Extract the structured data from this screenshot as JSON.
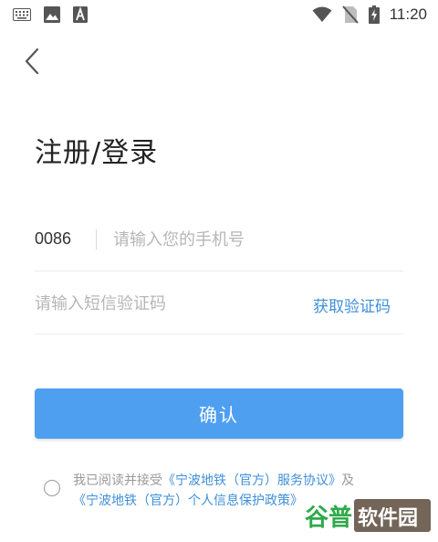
{
  "status_bar": {
    "time": "11:20",
    "left_icons": [
      "keyboard-icon",
      "image-icon",
      "font-a-icon"
    ],
    "right_icons": [
      "wifi-icon",
      "no-sim-icon",
      "battery-charging-icon"
    ]
  },
  "header": {
    "back_icon": "chevron-left-icon",
    "title": "注册/登录"
  },
  "form": {
    "country_code": "0086",
    "phone_placeholder": "请输入您的手机号",
    "code_placeholder": "请输入短信验证码",
    "get_code_label": "获取验证码",
    "confirm_label": "确认"
  },
  "agreement": {
    "prefix": "我已阅读并接受",
    "service_link": "《宁波地铁（官方）服务协议》",
    "joiner": "及",
    "privacy_link": "《宁波地铁（官方）个人信息保护政策》"
  },
  "watermark": {
    "text": "谷普软件园"
  },
  "colors": {
    "accent": "#4f9ff0",
    "link": "#3f8fd8",
    "placeholder": "#b6b6b6",
    "divider": "#ececec"
  }
}
